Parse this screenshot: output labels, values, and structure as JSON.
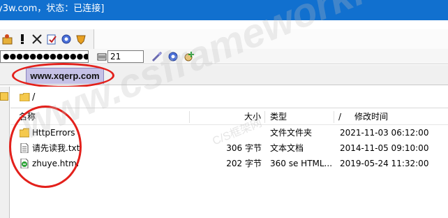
{
  "window": {
    "title": "y3w.com，状态：已连接]"
  },
  "toolbar": {
    "icons": [
      "connect-icon",
      "alert-icon",
      "close-icon",
      "edit-icon",
      "gear-icon",
      "shield-icon"
    ]
  },
  "connection": {
    "password": "●●●●●●●●●●●●●●●",
    "port": "21"
  },
  "tab": {
    "label": "www.xqerp.com"
  },
  "path": {
    "current": "/"
  },
  "columns": {
    "name": "名称",
    "size": "大小",
    "type": "类型",
    "sort": "/",
    "modified": "修改时间"
  },
  "files": [
    {
      "name": "HttpErrors",
      "size": "",
      "type": "文件文件夹",
      "modified": "2021-11-03 06:12:00",
      "icon": "folder-icon"
    },
    {
      "name": "请先读我.txt",
      "size": "306 字节",
      "type": "文本文档",
      "modified": "2014-11-05 09:10:00",
      "icon": "text-file-icon"
    },
    {
      "name": "zhuye.html",
      "size": "202 字节",
      "type": "360 se HTML...",
      "modified": "2019-05-24 11:32:00",
      "icon": "html-file-icon"
    }
  ],
  "watermark": {
    "text": "www.csframework.com",
    "sub": "C/S框架网"
  },
  "colors": {
    "titlebar": "#1170cf",
    "tab": "#c5c1e6",
    "highlight": "#e3201b"
  }
}
